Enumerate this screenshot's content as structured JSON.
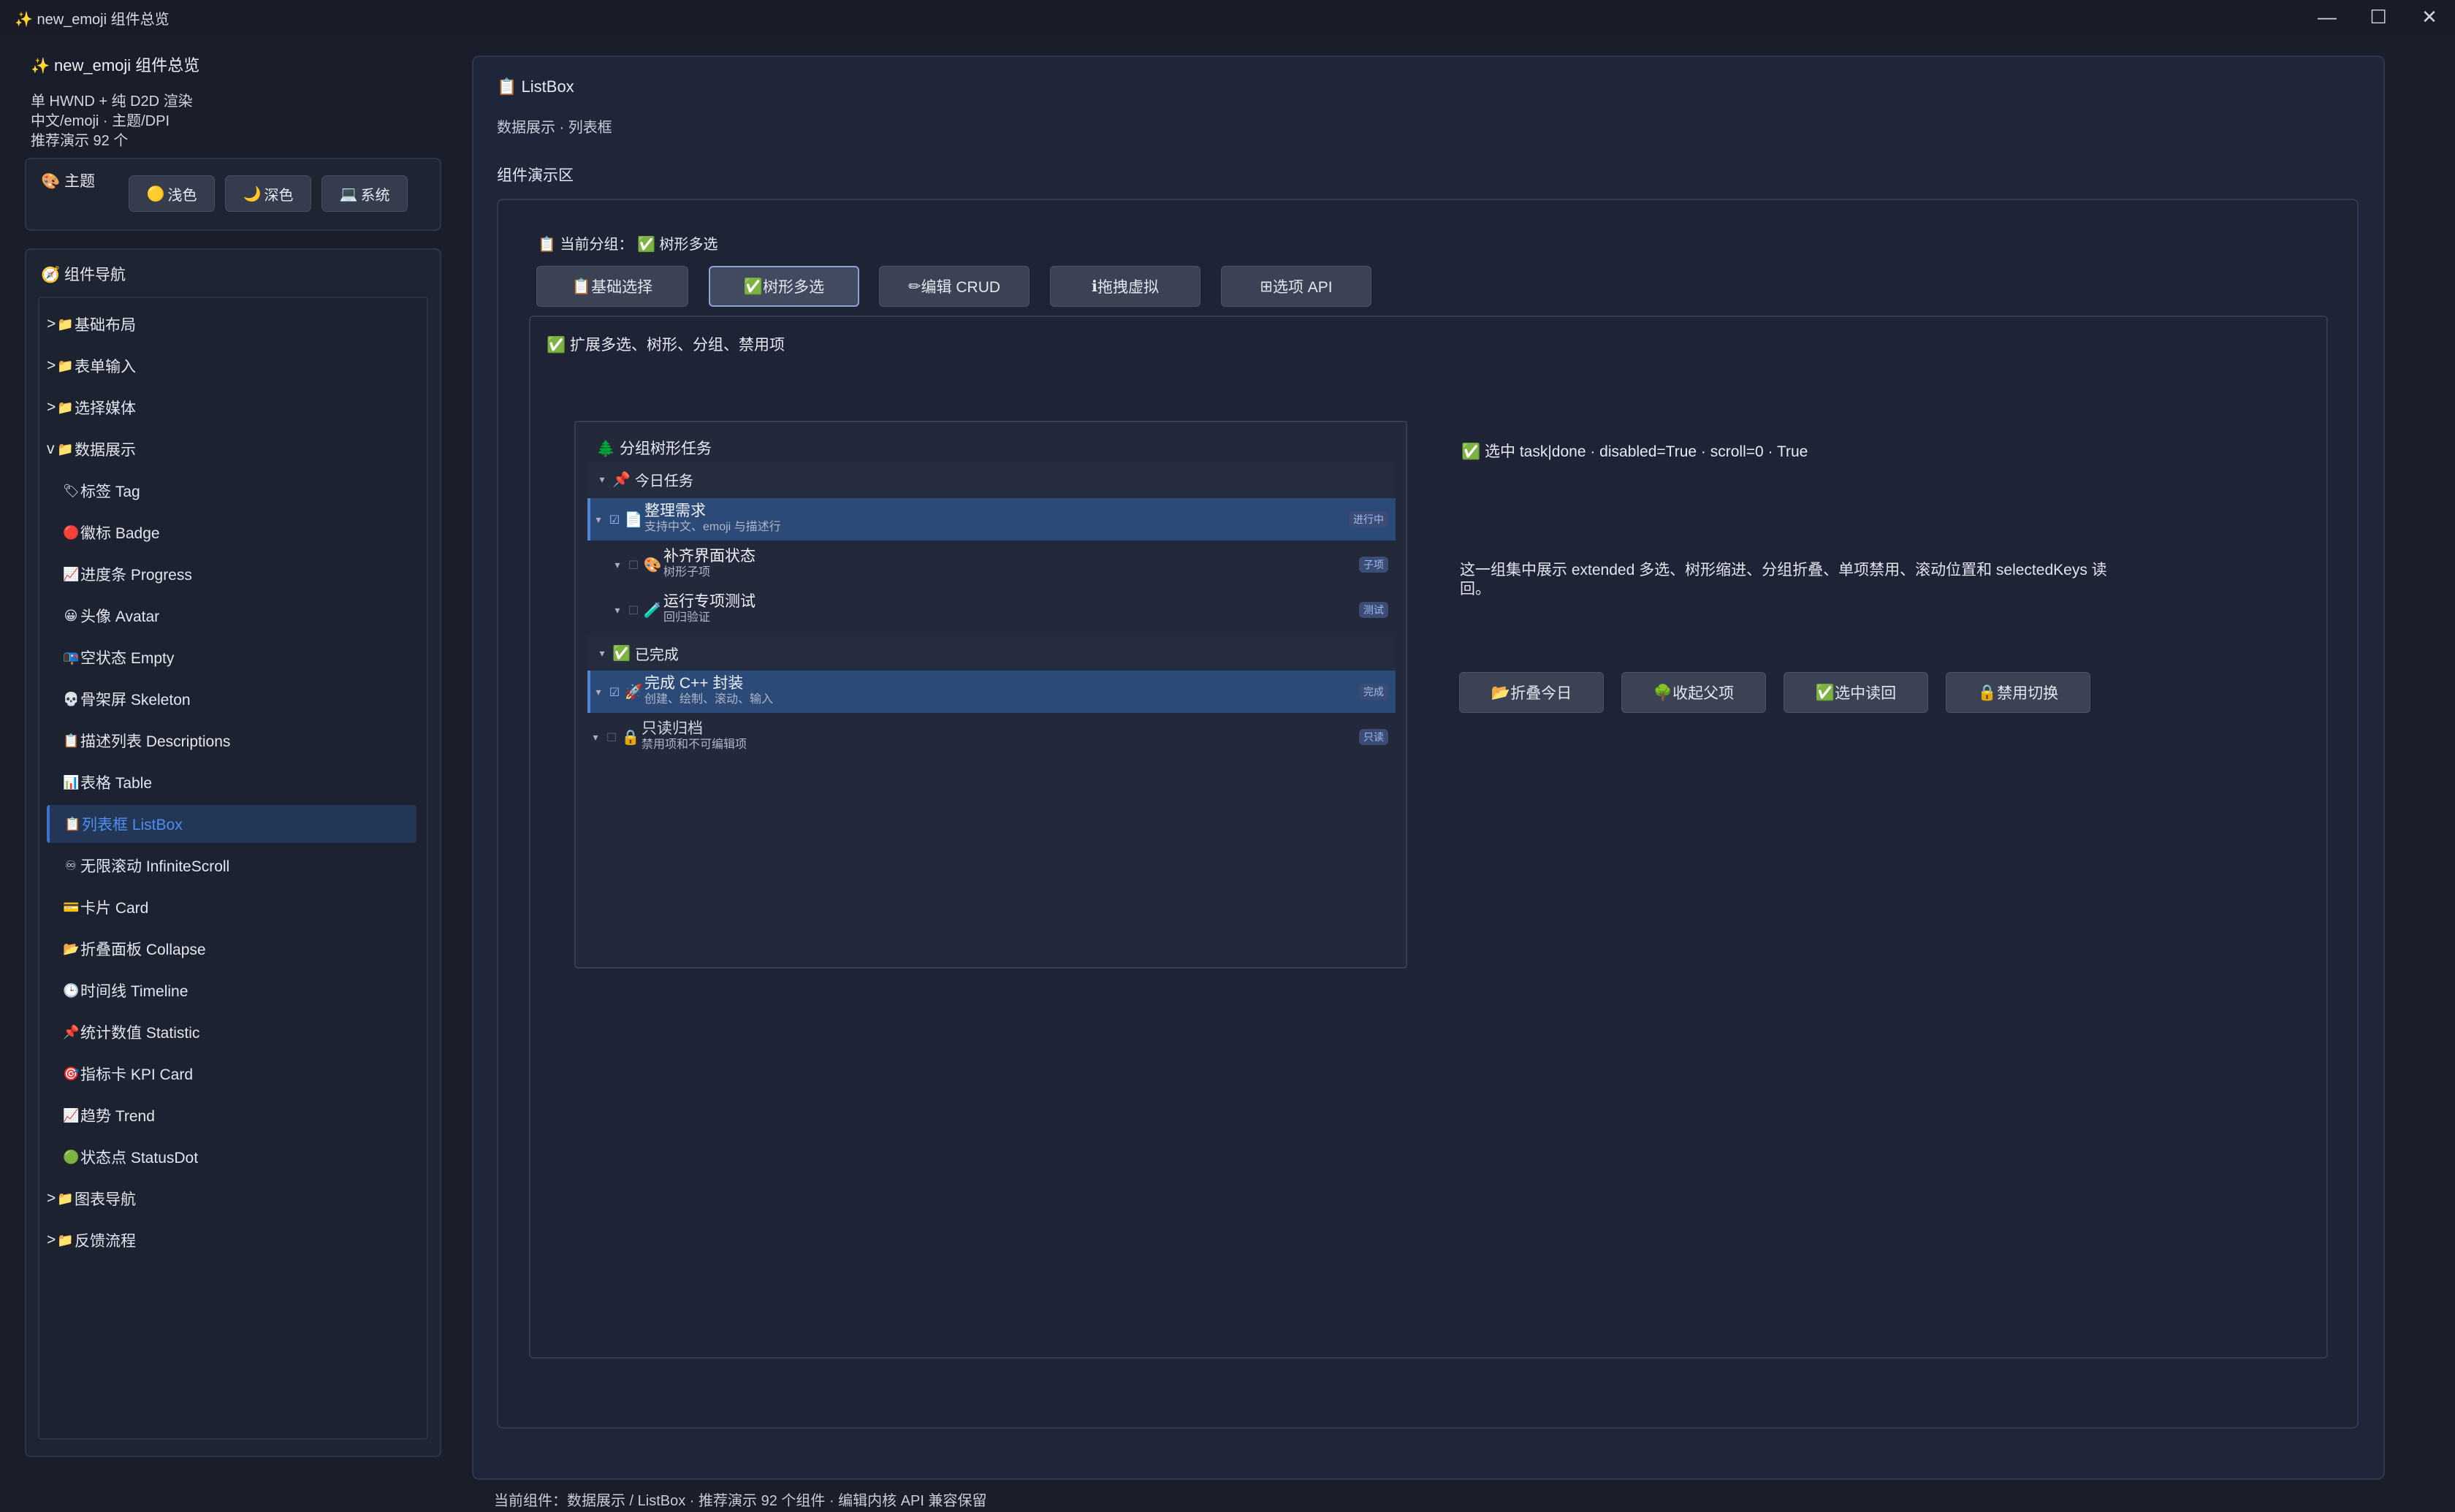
{
  "window": {
    "title": "✨ new_emoji 组件总览",
    "controls": [
      "—",
      "☐",
      "✕"
    ]
  },
  "sidebar": {
    "app_title": "new_emoji 组件总览",
    "info": [
      "单 HWND + 纯 D2D 渲染",
      "中文/emoji · 主题/DPI",
      "推荐演示 92 个"
    ],
    "theme": {
      "label": "主题",
      "buttons": [
        {
          "icon": "🟡",
          "label": "浅色"
        },
        {
          "icon": "🌙",
          "label": "深色"
        },
        {
          "icon": "💻",
          "label": "系统"
        }
      ]
    },
    "nav": {
      "title": "组件导航",
      "items": [
        {
          "prefix": ">",
          "icon": "📁",
          "label": "基础布局",
          "level": 0
        },
        {
          "prefix": ">",
          "icon": "📁",
          "label": "表单输入",
          "level": 0
        },
        {
          "prefix": ">",
          "icon": "📁",
          "label": "选择媒体",
          "level": 0
        },
        {
          "prefix": "v",
          "icon": "📁",
          "label": "数据展示",
          "level": 0
        },
        {
          "prefix": "",
          "icon": "🏷",
          "label": "标签 Tag",
          "level": 1
        },
        {
          "prefix": "",
          "icon": "🔴",
          "label": "徽标 Badge",
          "level": 1
        },
        {
          "prefix": "",
          "icon": "📈",
          "label": "进度条 Progress",
          "level": 1
        },
        {
          "prefix": "",
          "icon": "😀",
          "label": "头像 Avatar",
          "level": 1
        },
        {
          "prefix": "",
          "icon": "📭",
          "label": "空状态 Empty",
          "level": 1
        },
        {
          "prefix": "",
          "icon": "💀",
          "label": "骨架屏 Skeleton",
          "level": 1
        },
        {
          "prefix": "",
          "icon": "📋",
          "label": "描述列表 Descriptions",
          "level": 1
        },
        {
          "prefix": "",
          "icon": "📊",
          "label": "表格 Table",
          "level": 1
        },
        {
          "prefix": "",
          "icon": "📋",
          "label": "列表框 ListBox",
          "level": 1
        },
        {
          "prefix": "",
          "icon": "♾",
          "label": "无限滚动 InfiniteScroll",
          "level": 1
        },
        {
          "prefix": "",
          "icon": "💳",
          "label": "卡片 Card",
          "level": 1
        },
        {
          "prefix": "",
          "icon": "📂",
          "label": "折叠面板 Collapse",
          "level": 1
        },
        {
          "prefix": "",
          "icon": "🕒",
          "label": "时间线 Timeline",
          "level": 1
        },
        {
          "prefix": "",
          "icon": "📌",
          "label": "统计数值 Statistic",
          "level": 1
        },
        {
          "prefix": "",
          "icon": "🎯",
          "label": "指标卡 KPI Card",
          "level": 1
        },
        {
          "prefix": "",
          "icon": "📈",
          "label": "趋势 Trend",
          "level": 1
        },
        {
          "prefix": "",
          "icon": "🟢",
          "label": "状态点 StatusDot",
          "level": 1
        },
        {
          "prefix": ">",
          "icon": "📁",
          "label": "图表导航",
          "level": 0
        },
        {
          "prefix": ">",
          "icon": "📁",
          "label": "反馈流程",
          "level": 0
        }
      ]
    }
  },
  "main": {
    "title": "ListBox",
    "subtitle": "数据展示 · 列表框",
    "demo_label": "组件演示区",
    "group_label": "当前分组：",
    "group_value": "树形多选",
    "tabs": [
      {
        "icon": "📋",
        "label": "基础选择"
      },
      {
        "icon": "✅",
        "label": "树形多选"
      },
      {
        "icon": "✏",
        "label": "编辑 CRUD"
      },
      {
        "icon": "ℹ",
        "label": "拖拽虚拟"
      },
      {
        "icon": "⊞",
        "label": "选项 API"
      }
    ],
    "inner_heading": "扩展多选、树形、分组、禁用项",
    "tree": {
      "title": "分组树形任务",
      "groups": [
        {
          "label": "今日任务",
          "icon": "📌"
        },
        {
          "label": "已完成",
          "icon": "✅"
        }
      ],
      "rows": [
        {
          "title": "整理需求",
          "sub": "支持中文、emoji 与描述行",
          "badge": "进行中",
          "icon": "📄",
          "check": "☑"
        },
        {
          "title": "补齐界面状态",
          "sub": "树形子项",
          "badge": "子项",
          "icon": "🎨",
          "check": "☐"
        },
        {
          "title": "运行专项测试",
          "sub": "回归验证",
          "badge": "测试",
          "icon": "🧪",
          "check": "☐"
        },
        {
          "title": "完成 C++ 封装",
          "sub": "创建、绘制、滚动、输入",
          "badge": "完成",
          "icon": "🚀",
          "check": "☑"
        },
        {
          "title": "只读归档",
          "sub": "禁用项和不可编辑项",
          "badge": "只读",
          "icon": "🔒",
          "check": "☐"
        }
      ]
    },
    "status_line": "选中 task|done · disabled=True · scroll=0 · True",
    "description": "这一组集中展示 extended 多选、树形缩进、分组折叠、单项禁用、滚动位置和 selectedKeys 读回。",
    "actions": [
      {
        "icon": "📂",
        "label": "折叠今日"
      },
      {
        "icon": "🌳",
        "label": "收起父项"
      },
      {
        "icon": "✅",
        "label": "选中读回"
      },
      {
        "icon": "🔒",
        "label": "禁用切换"
      }
    ]
  },
  "footer": "当前组件：数据展示 / ListBox · 推荐演示 92 个组件 · 编辑内核 API 兼容保留",
  "colors": {
    "background": "#1a1e2b",
    "accent": "#3a73d0",
    "selected_row": "#2c4a78",
    "badge": "#3b4d74"
  }
}
